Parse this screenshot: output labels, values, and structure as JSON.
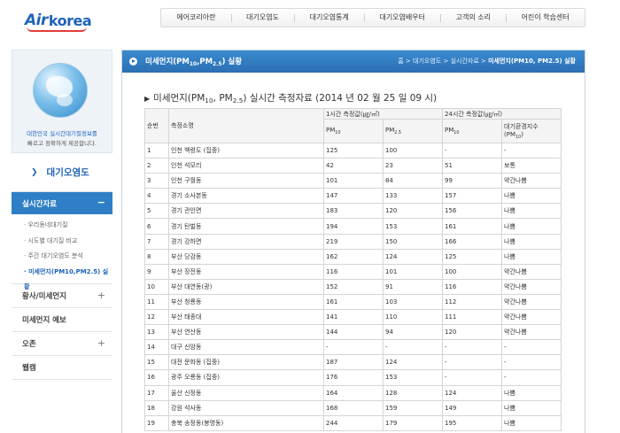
{
  "logo": {
    "air": "Air",
    "korea": "korea"
  },
  "gnb": [
    "에어코리아란",
    "대기오염도",
    "대기오염통계",
    "대기오염배우터",
    "고객의 소리",
    "어린이 학습센터"
  ],
  "sidebar": {
    "promo_line1": "대한민국 실시간대기질정보를",
    "promo_line2": "빠르고 정확하게 제공합니다.",
    "section_title": "대기오염도",
    "active_menu": "실시간자료",
    "submenu": [
      "우리동네대기질",
      "시도별 대기질 비교",
      "주간 대기오염도 분석",
      "미세먼지(PM10,PM2.5) 실황"
    ],
    "menus": [
      {
        "label": "황사/미세먼지",
        "expandable": true
      },
      {
        "label": "미세먼지 예보",
        "expandable": false
      },
      {
        "label": "오존",
        "expandable": true
      },
      {
        "label": "웹캠",
        "expandable": false
      }
    ]
  },
  "content": {
    "title_prefix": "미세먼지(PM",
    "title_sub1": "10",
    "title_mid": ",PM",
    "title_sub2": "2.5",
    "title_suffix": ") 실황",
    "breadcrumb": [
      "홈",
      "대기오염도",
      "실시간자료",
      "미세먼지(PM10, PM2.5) 실황"
    ],
    "heading_prefix": "미세먼지(PM",
    "heading_sub1": "10",
    "heading_mid": ", PM",
    "heading_sub2": "2.5",
    "heading_suffix": ") 실시간 측정자료 (2014 년 02 월 25 일 09 시)"
  },
  "table": {
    "col_seq": "순번",
    "col_station": "측정소명",
    "group_realtime": "1시간 측정값(㎍/㎥)",
    "group_24h": "24시간 측정값(㎍/㎥)",
    "pm": "PM",
    "sub10": "10",
    "sub25": "2.5",
    "aqi_label": "대기환경지수",
    "aqi_pm_prefix": "(PM",
    "aqi_pm_suffix": ")",
    "rows": [
      [
        "1",
        "인천 백령도 (집중)",
        "125",
        "100",
        "-",
        "-"
      ],
      [
        "2",
        "인천 석모리",
        "42",
        "23",
        "51",
        "보통"
      ],
      [
        "3",
        "인천 구월동",
        "101",
        "84",
        "99",
        "약간나쁨"
      ],
      [
        "4",
        "경기 소사본동",
        "147",
        "133",
        "157",
        "나쁨"
      ],
      [
        "5",
        "경기 관인면",
        "183",
        "120",
        "156",
        "나쁨"
      ],
      [
        "6",
        "경기 탄벌동",
        "194",
        "153",
        "161",
        "나쁨"
      ],
      [
        "7",
        "경기 강하면",
        "219",
        "150",
        "166",
        "나쁨"
      ],
      [
        "8",
        "부산 당감동",
        "162",
        "124",
        "125",
        "나쁨"
      ],
      [
        "9",
        "부산 장전동",
        "116",
        "101",
        "100",
        "약간나쁨"
      ],
      [
        "10",
        "부산 대연동(광)",
        "152",
        "91",
        "116",
        "약간나쁨"
      ],
      [
        "11",
        "부산 청룡동",
        "161",
        "103",
        "112",
        "약간나쁨"
      ],
      [
        "12",
        "부산 태종대",
        "141",
        "110",
        "111",
        "약간나쁨"
      ],
      [
        "13",
        "부산 연산동",
        "144",
        "94",
        "120",
        "약간나쁨"
      ],
      [
        "14",
        "대구 신암동",
        "-",
        "-",
        "-",
        "-"
      ],
      [
        "15",
        "대전 문화동 (집중)",
        "187",
        "124",
        "-",
        "-"
      ],
      [
        "16",
        "광주 오룡동 (집중)",
        "176",
        "153",
        "-",
        "-"
      ],
      [
        "17",
        "울산 신정동",
        "164",
        "128",
        "124",
        "나쁨"
      ],
      [
        "18",
        "강원 석사동",
        "168",
        "159",
        "149",
        "나쁨"
      ],
      [
        "19",
        "충북 송정동(봉명동)",
        "244",
        "179",
        "195",
        "나쁨"
      ]
    ]
  }
}
